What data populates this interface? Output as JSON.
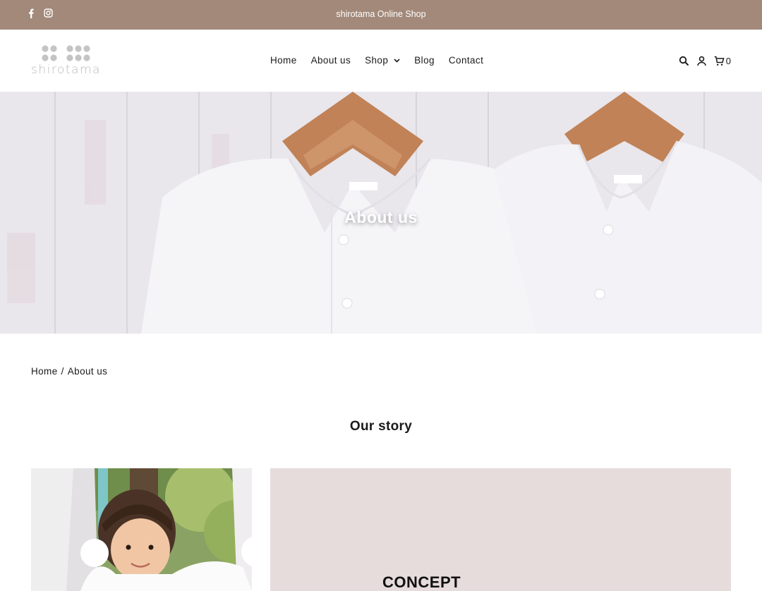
{
  "announcement": {
    "text": "shirotama Online Shop"
  },
  "social": [
    "facebook-icon",
    "instagram-icon"
  ],
  "logo": {
    "text": "shirotama"
  },
  "nav": {
    "items": [
      {
        "label": "Home"
      },
      {
        "label": "About us"
      },
      {
        "label": "Shop",
        "has_dropdown": true
      },
      {
        "label": "Blog"
      },
      {
        "label": "Contact"
      }
    ]
  },
  "header_icons": {
    "cart_count": "0"
  },
  "hero": {
    "title": "About us"
  },
  "breadcrumb": {
    "home": "Home",
    "separator": "/",
    "current": "About us"
  },
  "section": {
    "title": "Our story"
  },
  "concept": {
    "heading": "CONCEPT"
  },
  "colors": {
    "announcement_bg": "#a3897a",
    "concept_bg": "#e6dcdb",
    "text": "#1a1a1a"
  }
}
